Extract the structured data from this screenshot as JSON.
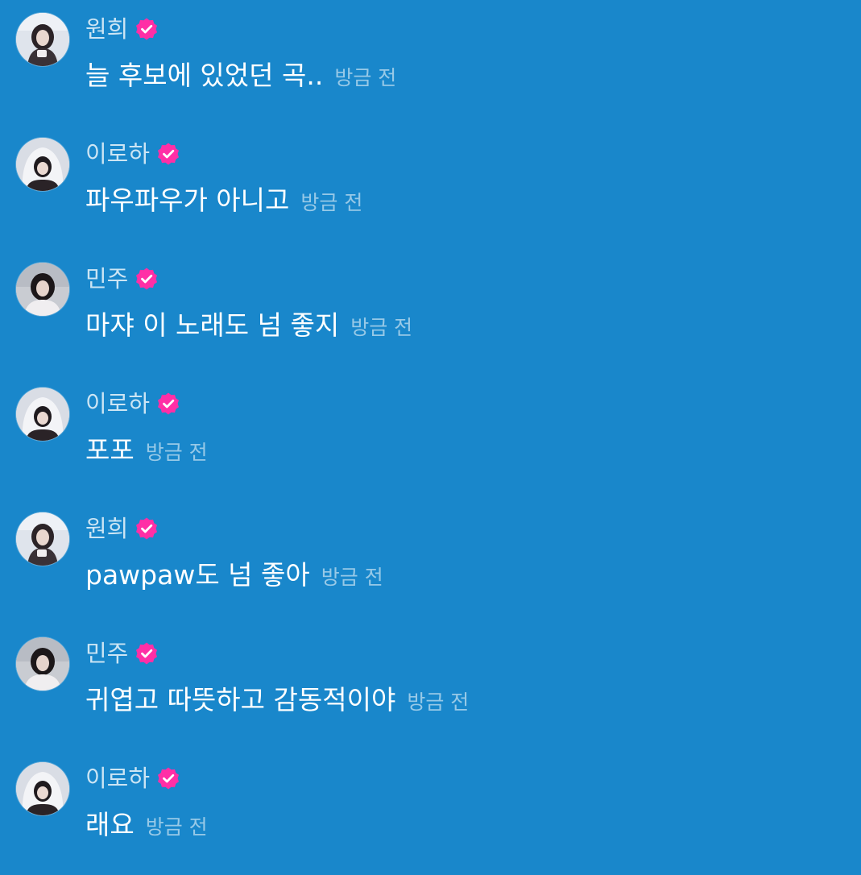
{
  "colors": {
    "background": "#1987cb",
    "verified_badge": "#ff2fa6",
    "name_text": "#c7e2f4",
    "time_text": "#9ecbe9"
  },
  "messages": [
    {
      "author": "원희",
      "verified_icon": "verified-badge-icon",
      "text": "늘 후보에 있었던 곡..",
      "time": "방금 전"
    },
    {
      "author": "이로하",
      "verified_icon": "verified-badge-icon",
      "text": "파우파우가 아니고",
      "time": "방금 전"
    },
    {
      "author": "민주",
      "verified_icon": "verified-badge-icon",
      "text": "마쟈 이 노래도 넘 좋지",
      "time": "방금 전"
    },
    {
      "author": "이로하",
      "verified_icon": "verified-badge-icon",
      "text": "포포",
      "time": "방금 전"
    },
    {
      "author": "원희",
      "verified_icon": "verified-badge-icon",
      "text": "pawpaw도 넘 좋아",
      "time": "방금 전"
    },
    {
      "author": "민주",
      "verified_icon": "verified-badge-icon",
      "text": "귀엽고 따뜻하고 감동적이야",
      "time": "방금 전"
    },
    {
      "author": "이로하",
      "verified_icon": "verified-badge-icon",
      "text": "래요",
      "time": "방금 전"
    }
  ]
}
